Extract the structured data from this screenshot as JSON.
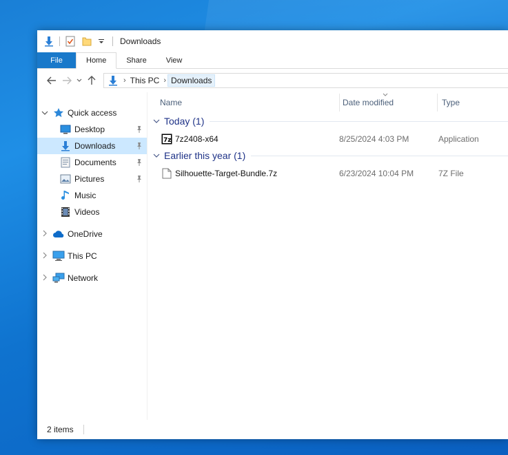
{
  "window": {
    "title": "Downloads"
  },
  "ribbon": {
    "tabs": [
      {
        "label": "File"
      },
      {
        "label": "Home"
      },
      {
        "label": "Share"
      },
      {
        "label": "View"
      }
    ]
  },
  "address": {
    "crumbs": [
      "This PC",
      "Downloads"
    ]
  },
  "nav_pane": {
    "quick_access": "Quick access",
    "items": [
      {
        "label": "Desktop",
        "icon": "desktop-icon",
        "pinned": true
      },
      {
        "label": "Downloads",
        "icon": "downloads-icon",
        "pinned": true,
        "selected": true
      },
      {
        "label": "Documents",
        "icon": "documents-icon",
        "pinned": true
      },
      {
        "label": "Pictures",
        "icon": "pictures-icon",
        "pinned": true
      },
      {
        "label": "Music",
        "icon": "music-icon",
        "pinned": false
      },
      {
        "label": "Videos",
        "icon": "videos-icon",
        "pinned": false
      }
    ],
    "onedrive": "OneDrive",
    "this_pc": "This PC",
    "network": "Network"
  },
  "columns": {
    "name": "Name",
    "date": "Date modified",
    "type": "Type"
  },
  "groups": [
    {
      "header": "Today (1)",
      "files": [
        {
          "name": "7z2408-x64",
          "date": "8/25/2024 4:03 PM",
          "type": "Application",
          "icon": "7zip-app-icon"
        }
      ]
    },
    {
      "header": "Earlier this year (1)",
      "files": [
        {
          "name": "Silhouette-Target-Bundle.7z",
          "date": "6/23/2024 10:04 PM",
          "type": "7Z File",
          "icon": "blank-file-icon"
        }
      ]
    }
  ],
  "status": {
    "item_count": "2 items"
  },
  "colors": {
    "accent": "#1979ca",
    "selection": "#cce8ff",
    "group_header": "#1e3287"
  }
}
